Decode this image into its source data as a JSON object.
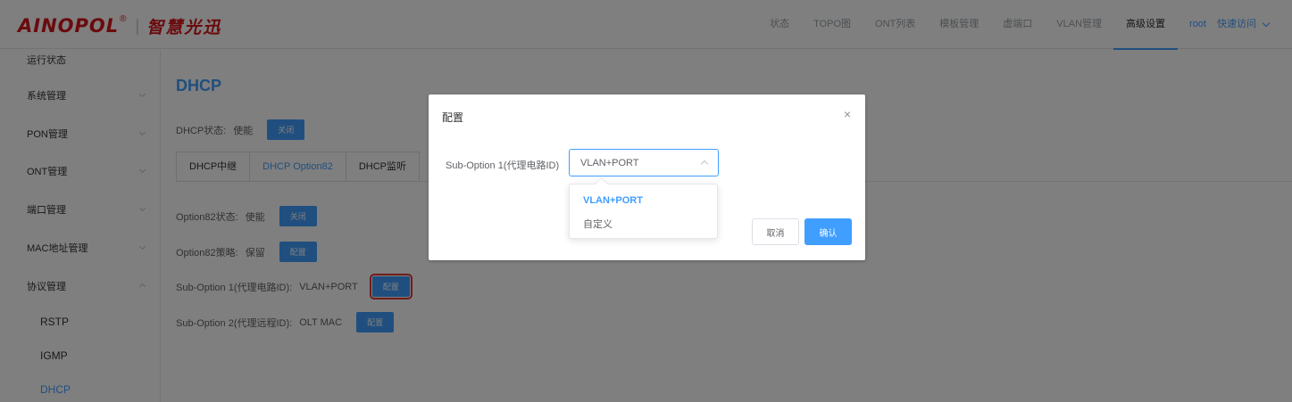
{
  "logo": {
    "brand": "AINOPOL",
    "reg": "®",
    "sep": "|",
    "cn": "智慧光迅"
  },
  "nav": {
    "items": [
      "状态",
      "TOPO图",
      "ONT列表",
      "模板管理",
      "虚端口",
      "VLAN管理",
      "高级设置"
    ],
    "active_index": 6,
    "user": "root",
    "quick": "快速访问"
  },
  "sidebar": {
    "items": [
      "运行状态",
      "系统管理",
      "PON管理",
      "ONT管理",
      "端口管理",
      "MAC地址管理",
      "协议管理"
    ],
    "subitems": [
      "RSTP",
      "IGMP",
      "DHCP"
    ],
    "active_sub": "DHCP"
  },
  "page": {
    "title": "DHCP",
    "status": {
      "label": "DHCP状态:",
      "value": "使能",
      "button": "关闭"
    },
    "tabs": [
      "DHCP中继",
      "DHCP Option82",
      "DHCP监听"
    ],
    "active_tab": 1,
    "opt82_state": {
      "label": "Option82状态:",
      "value": "使能",
      "button": "关闭"
    },
    "opt82_policy": {
      "label": "Option82策略:",
      "value": "保留",
      "button": "配置"
    },
    "sub1": {
      "label": "Sub-Option 1(代理电路ID):",
      "value": "VLAN+PORT",
      "button": "配置"
    },
    "sub2": {
      "label": "Sub-Option 2(代理远程ID):",
      "value": "OLT MAC",
      "button": "配置"
    }
  },
  "dialog": {
    "title": "配置",
    "close": "×",
    "field_label": "Sub-Option 1(代理电路ID)",
    "select_value": "VLAN+PORT",
    "options": [
      "VLAN+PORT",
      "自定义"
    ],
    "selected_option": 0,
    "cancel": "取消",
    "confirm": "确认"
  },
  "colors": {
    "accent": "#409eff",
    "brand_red": "#d7141a",
    "highlight": "#e53935"
  }
}
